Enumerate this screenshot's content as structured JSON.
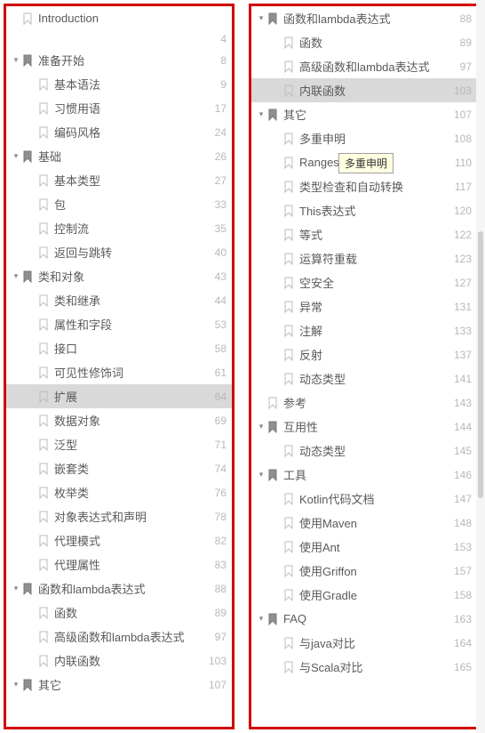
{
  "tooltip_text": "多重申明",
  "left_panel": {
    "items": [
      {
        "label": "Introduction",
        "page": "",
        "level": 0,
        "expanded": false,
        "has_children": false,
        "open": false,
        "selected": false
      },
      {
        "label": "",
        "page": "4",
        "level": 0,
        "is_pageline": true
      },
      {
        "label": "准备开始",
        "page": "8",
        "level": 0,
        "expanded": true,
        "has_children": true,
        "open": true,
        "selected": false
      },
      {
        "label": "基本语法",
        "page": "9",
        "level": 1,
        "expanded": false,
        "has_children": false,
        "open": false,
        "selected": false
      },
      {
        "label": "习惯用语",
        "page": "17",
        "level": 1,
        "expanded": false,
        "has_children": false,
        "open": false,
        "selected": false
      },
      {
        "label": "编码风格",
        "page": "24",
        "level": 1,
        "expanded": false,
        "has_children": false,
        "open": false,
        "selected": false
      },
      {
        "label": "基础",
        "page": "26",
        "level": 0,
        "expanded": true,
        "has_children": true,
        "open": true,
        "selected": false
      },
      {
        "label": "基本类型",
        "page": "27",
        "level": 1,
        "expanded": false,
        "has_children": false,
        "open": false,
        "selected": false
      },
      {
        "label": "包",
        "page": "33",
        "level": 1,
        "expanded": false,
        "has_children": false,
        "open": false,
        "selected": false
      },
      {
        "label": "控制流",
        "page": "35",
        "level": 1,
        "expanded": false,
        "has_children": false,
        "open": false,
        "selected": false
      },
      {
        "label": "返回与跳转",
        "page": "40",
        "level": 1,
        "expanded": false,
        "has_children": false,
        "open": false,
        "selected": false
      },
      {
        "label": "类和对象",
        "page": "43",
        "level": 0,
        "expanded": true,
        "has_children": true,
        "open": true,
        "selected": false
      },
      {
        "label": "类和继承",
        "page": "44",
        "level": 1,
        "expanded": false,
        "has_children": false,
        "open": false,
        "selected": false
      },
      {
        "label": "属性和字段",
        "page": "53",
        "level": 1,
        "expanded": false,
        "has_children": false,
        "open": false,
        "selected": false
      },
      {
        "label": "接口",
        "page": "58",
        "level": 1,
        "expanded": false,
        "has_children": false,
        "open": false,
        "selected": false
      },
      {
        "label": "可见性修饰词",
        "page": "61",
        "level": 1,
        "expanded": false,
        "has_children": false,
        "open": false,
        "selected": false
      },
      {
        "label": "扩展",
        "page": "64",
        "level": 1,
        "expanded": false,
        "has_children": false,
        "open": false,
        "selected": true
      },
      {
        "label": "数据对象",
        "page": "69",
        "level": 1,
        "expanded": false,
        "has_children": false,
        "open": false,
        "selected": false
      },
      {
        "label": "泛型",
        "page": "71",
        "level": 1,
        "expanded": false,
        "has_children": false,
        "open": false,
        "selected": false
      },
      {
        "label": "嵌套类",
        "page": "74",
        "level": 1,
        "expanded": false,
        "has_children": false,
        "open": false,
        "selected": false
      },
      {
        "label": "枚举类",
        "page": "76",
        "level": 1,
        "expanded": false,
        "has_children": false,
        "open": false,
        "selected": false
      },
      {
        "label": "对象表达式和声明",
        "page": "78",
        "level": 1,
        "expanded": false,
        "has_children": false,
        "open": false,
        "selected": false
      },
      {
        "label": "代理模式",
        "page": "82",
        "level": 1,
        "expanded": false,
        "has_children": false,
        "open": false,
        "selected": false
      },
      {
        "label": "代理属性",
        "page": "83",
        "level": 1,
        "expanded": false,
        "has_children": false,
        "open": false,
        "selected": false
      },
      {
        "label": "函数和lambda表达式",
        "page": "88",
        "level": 0,
        "expanded": true,
        "has_children": true,
        "open": true,
        "selected": false
      },
      {
        "label": "函数",
        "page": "89",
        "level": 1,
        "expanded": false,
        "has_children": false,
        "open": false,
        "selected": false
      },
      {
        "label": "高级函数和lambda表达式",
        "page": "97",
        "level": 1,
        "expanded": false,
        "has_children": false,
        "open": false,
        "selected": false
      },
      {
        "label": "内联函数",
        "page": "103",
        "level": 1,
        "expanded": false,
        "has_children": false,
        "open": false,
        "selected": false
      },
      {
        "label": "其它",
        "page": "107",
        "level": 0,
        "expanded": true,
        "has_children": true,
        "open": true,
        "selected": false
      }
    ]
  },
  "right_panel": {
    "tooltip_row_index": 6,
    "items": [
      {
        "label": "函数和lambda表达式",
        "page": "88",
        "level": 0,
        "expanded": true,
        "has_children": true,
        "open": true,
        "selected": false
      },
      {
        "label": "函数",
        "page": "89",
        "level": 1,
        "expanded": false,
        "has_children": false,
        "open": false,
        "selected": false
      },
      {
        "label": "高级函数和lambda表达式",
        "page": "97",
        "level": 1,
        "expanded": false,
        "has_children": false,
        "open": false,
        "selected": false
      },
      {
        "label": "内联函数",
        "page": "103",
        "level": 1,
        "expanded": false,
        "has_children": false,
        "open": false,
        "selected": true
      },
      {
        "label": "其它",
        "page": "107",
        "level": 0,
        "expanded": true,
        "has_children": true,
        "open": true,
        "selected": false
      },
      {
        "label": "多重申明",
        "page": "108",
        "level": 1,
        "expanded": false,
        "has_children": false,
        "open": false,
        "selected": false
      },
      {
        "label": "Ranges",
        "page": "110",
        "level": 1,
        "expanded": false,
        "has_children": false,
        "open": false,
        "selected": false
      },
      {
        "label": "类型检查和自动转换",
        "page": "117",
        "level": 1,
        "expanded": false,
        "has_children": false,
        "open": false,
        "selected": false
      },
      {
        "label": "This表达式",
        "page": "120",
        "level": 1,
        "expanded": false,
        "has_children": false,
        "open": false,
        "selected": false
      },
      {
        "label": "等式",
        "page": "122",
        "level": 1,
        "expanded": false,
        "has_children": false,
        "open": false,
        "selected": false
      },
      {
        "label": "运算符重载",
        "page": "123",
        "level": 1,
        "expanded": false,
        "has_children": false,
        "open": false,
        "selected": false
      },
      {
        "label": "空安全",
        "page": "127",
        "level": 1,
        "expanded": false,
        "has_children": false,
        "open": false,
        "selected": false
      },
      {
        "label": "异常",
        "page": "131",
        "level": 1,
        "expanded": false,
        "has_children": false,
        "open": false,
        "selected": false
      },
      {
        "label": "注解",
        "page": "133",
        "level": 1,
        "expanded": false,
        "has_children": false,
        "open": false,
        "selected": false
      },
      {
        "label": "反射",
        "page": "137",
        "level": 1,
        "expanded": false,
        "has_children": false,
        "open": false,
        "selected": false
      },
      {
        "label": "动态类型",
        "page": "141",
        "level": 1,
        "expanded": false,
        "has_children": false,
        "open": false,
        "selected": false
      },
      {
        "label": "参考",
        "page": "143",
        "level": 0,
        "expanded": false,
        "has_children": false,
        "open": false,
        "selected": false
      },
      {
        "label": "互用性",
        "page": "144",
        "level": 0,
        "expanded": true,
        "has_children": true,
        "open": true,
        "selected": false
      },
      {
        "label": "动态类型",
        "page": "145",
        "level": 1,
        "expanded": false,
        "has_children": false,
        "open": false,
        "selected": false
      },
      {
        "label": "工具",
        "page": "146",
        "level": 0,
        "expanded": true,
        "has_children": true,
        "open": true,
        "selected": false
      },
      {
        "label": "Kotlin代码文档",
        "page": "147",
        "level": 1,
        "expanded": false,
        "has_children": false,
        "open": false,
        "selected": false
      },
      {
        "label": "使用Maven",
        "page": "148",
        "level": 1,
        "expanded": false,
        "has_children": false,
        "open": false,
        "selected": false
      },
      {
        "label": "使用Ant",
        "page": "153",
        "level": 1,
        "expanded": false,
        "has_children": false,
        "open": false,
        "selected": false
      },
      {
        "label": "使用Griffon",
        "page": "157",
        "level": 1,
        "expanded": false,
        "has_children": false,
        "open": false,
        "selected": false
      },
      {
        "label": "使用Gradle",
        "page": "158",
        "level": 1,
        "expanded": false,
        "has_children": false,
        "open": false,
        "selected": false
      },
      {
        "label": "FAQ",
        "page": "163",
        "level": 0,
        "expanded": true,
        "has_children": true,
        "open": true,
        "selected": false
      },
      {
        "label": "与java对比",
        "page": "164",
        "level": 1,
        "expanded": false,
        "has_children": false,
        "open": false,
        "selected": false
      },
      {
        "label": "与Scala对比",
        "page": "165",
        "level": 1,
        "expanded": false,
        "has_children": false,
        "open": false,
        "selected": false
      }
    ]
  }
}
